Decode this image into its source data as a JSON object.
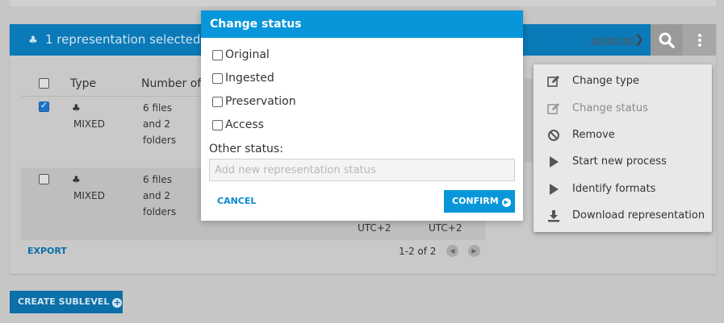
{
  "header": {
    "title": "1 representation selected",
    "advanced_label": "advanced"
  },
  "table": {
    "columns": [
      "Type",
      "Number of"
    ],
    "rows": [
      {
        "checked": true,
        "type": "MIXED",
        "files": [
          "6 files",
          "and 2",
          "folders"
        ]
      },
      {
        "checked": false,
        "type": "MIXED",
        "files": [
          "6 files",
          "and 2",
          "folders"
        ]
      }
    ],
    "utc": [
      "UTC+2",
      "UTC+2"
    ],
    "export_label": "EXPORT",
    "pager_text": "1-2 of 2"
  },
  "create_sublevel_label": "CREATE SUBLEVEL",
  "menu": {
    "items": [
      {
        "label": "Change type",
        "icon": "edit-icon",
        "disabled": false
      },
      {
        "label": "Change status",
        "icon": "edit-icon",
        "disabled": true
      },
      {
        "label": "Remove",
        "icon": "ban-icon",
        "disabled": false
      },
      {
        "label": "Start new process",
        "icon": "play-icon",
        "disabled": false
      },
      {
        "label": "Identify formats",
        "icon": "play-icon",
        "disabled": false
      },
      {
        "label": "Download representation",
        "icon": "download-icon",
        "disabled": false
      }
    ]
  },
  "modal": {
    "title": "Change status",
    "options": [
      "Original",
      "Ingested",
      "Preservation",
      "Access"
    ],
    "other_label": "Other status:",
    "other_placeholder": "Add new representation status",
    "cancel_label": "CANCEL",
    "confirm_label": "CONFIRM"
  },
  "colors": {
    "header_blue": "#0b7ab8",
    "modal_blue": "#0796d9"
  }
}
